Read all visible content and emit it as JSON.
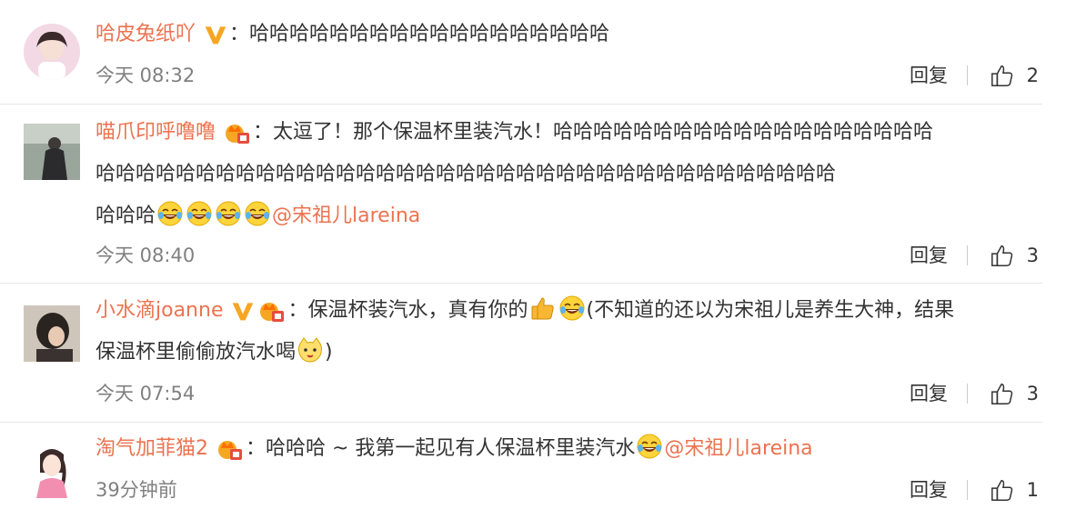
{
  "comments": [
    {
      "username": "哈皮兔纸吖",
      "text_lines": [
        "：哈哈哈哈哈哈哈哈哈哈哈哈哈哈哈哈哈哈"
      ],
      "time": "今天 08:32",
      "reply_label": "回复",
      "likes": "2"
    },
    {
      "username": "喵爪印呼噜噜",
      "text_lines": [
        "：太逗了！那个保温杯里装汽水！哈哈哈哈哈哈哈哈哈哈哈哈哈哈哈哈哈哈哈",
        "哈哈哈哈哈哈哈哈哈哈哈哈哈哈哈哈哈哈哈哈哈哈哈哈哈哈哈哈哈哈哈哈哈哈哈哈哈",
        "哈哈哈"
      ],
      "mention": "@宋祖儿lareina",
      "time": "今天 08:40",
      "reply_label": "回复",
      "likes": "3"
    },
    {
      "username": "小水滴joanne",
      "text_a": "：保温杯装汽水，真有你的",
      "text_b": "(不知道的还以为宋祖儿是养生大神，结果",
      "text_c": "保温杯里偷偷放汽水喝",
      "text_d": ")",
      "time": "今天 07:54",
      "reply_label": "回复",
      "likes": "3"
    },
    {
      "username": "淘气加菲猫2",
      "text_lines": [
        "：哈哈哈 ~ 我第一起见有人保温杯里装汽水"
      ],
      "mention": "@宋祖儿lareina",
      "time": "39分钟前",
      "reply_label": "回复",
      "likes": "1"
    }
  ],
  "colors": {
    "username": "#eb7350",
    "time": "#808080",
    "text": "#333333",
    "vip_badge": "#f5a623",
    "divider": "#e6e6e6"
  },
  "icons": [
    "vip-v-icon",
    "member-crown-icon",
    "laugh-cry-emoji-icon",
    "thumbs-up-emoji-icon",
    "cat-face-emoji-icon",
    "thumbs-up-icon"
  ]
}
